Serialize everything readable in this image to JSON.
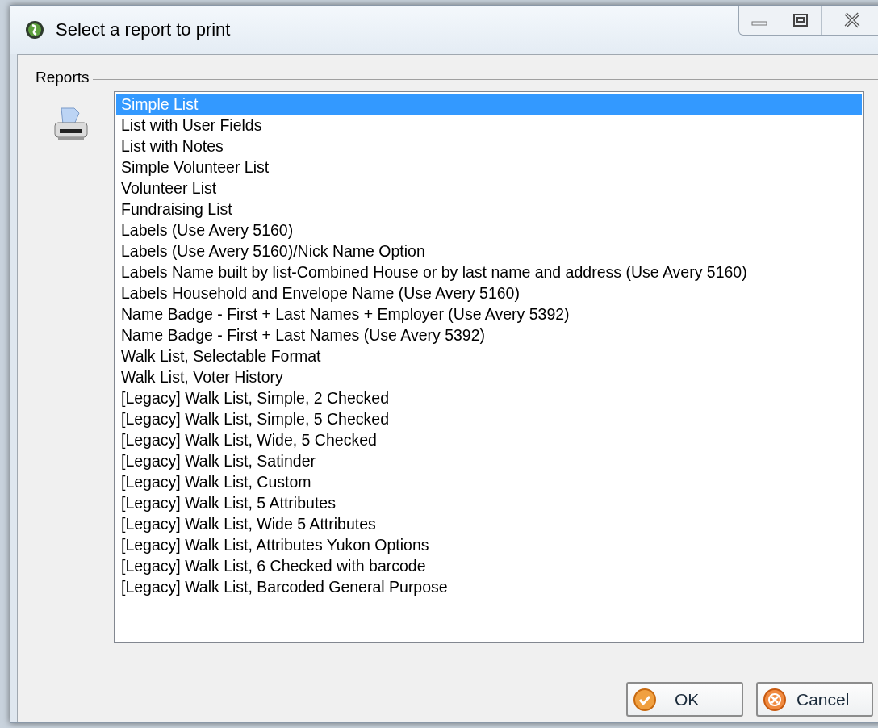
{
  "window": {
    "title": "Select a report to print"
  },
  "reports": {
    "label": "Reports",
    "items": [
      {
        "label": "Simple List",
        "selected": true
      },
      {
        "label": "List with User Fields",
        "selected": false
      },
      {
        "label": "List with Notes",
        "selected": false
      },
      {
        "label": "Simple Volunteer List",
        "selected": false
      },
      {
        "label": "Volunteer List",
        "selected": false
      },
      {
        "label": "Fundraising List",
        "selected": false
      },
      {
        "label": "Labels (Use Avery 5160)",
        "selected": false
      },
      {
        "label": "Labels (Use Avery 5160)/Nick Name Option",
        "selected": false
      },
      {
        "label": "Labels Name built by list-Combined House or by last name and address (Use Avery 5160)",
        "selected": false
      },
      {
        "label": "Labels Household and Envelope Name (Use Avery 5160)",
        "selected": false
      },
      {
        "label": "Name Badge - First + Last Names + Employer (Use Avery 5392)",
        "selected": false
      },
      {
        "label": "Name Badge - First + Last Names (Use Avery 5392)",
        "selected": false
      },
      {
        "label": "Walk List, Selectable Format",
        "selected": false
      },
      {
        "label": "Walk List, Voter History",
        "selected": false
      },
      {
        "label": "[Legacy] Walk List, Simple, 2 Checked",
        "selected": false
      },
      {
        "label": "[Legacy] Walk List, Simple, 5 Checked",
        "selected": false
      },
      {
        "label": "[Legacy] Walk List, Wide, 5 Checked",
        "selected": false
      },
      {
        "label": "[Legacy] Walk List, Satinder",
        "selected": false
      },
      {
        "label": "[Legacy] Walk List, Custom",
        "selected": false
      },
      {
        "label": "[Legacy] Walk List, 5 Attributes",
        "selected": false
      },
      {
        "label": "[Legacy] Walk List, Wide 5 Attributes",
        "selected": false
      },
      {
        "label": "[Legacy] Walk List, Attributes Yukon Options",
        "selected": false
      },
      {
        "label": "[Legacy] Walk List, 6 Checked with barcode",
        "selected": false
      },
      {
        "label": "[Legacy] Walk List, Barcoded General Purpose",
        "selected": false
      }
    ]
  },
  "buttons": [
    {
      "label": "OK",
      "kind": "ok"
    },
    {
      "label": "Cancel",
      "kind": "cancel"
    }
  ]
}
